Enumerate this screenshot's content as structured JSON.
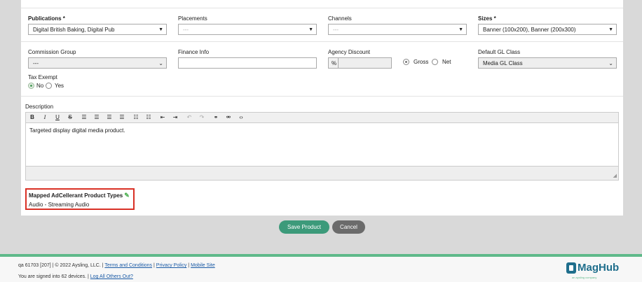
{
  "form": {
    "publications": {
      "label": "Publications *",
      "value": "Digital British Baking, Digital Pub"
    },
    "placements": {
      "label": "Placements",
      "value": "---"
    },
    "channels": {
      "label": "Channels",
      "value": "---"
    },
    "sizes": {
      "label": "Sizes *",
      "value": "Banner (100x200), Banner (200x300)"
    },
    "commission_group": {
      "label": "Commission Group",
      "value": "---"
    },
    "finance_info": {
      "label": "Finance Info",
      "value": ""
    },
    "agency_discount": {
      "label": "Agency Discount",
      "addon": "%",
      "value": ""
    },
    "gross_net": {
      "gross_label": "Gross",
      "net_label": "Net",
      "selected": "Gross"
    },
    "default_gl_class": {
      "label": "Default GL Class",
      "value": "Media GL Class"
    },
    "tax_exempt": {
      "label": "Tax Exempt",
      "no_label": "No",
      "yes_label": "Yes",
      "selected": "No"
    },
    "description": {
      "label": "Description",
      "text": "Targeted display digital media product."
    },
    "mapped": {
      "title": "Mapped AdCellerant Product Types",
      "value": "Audio - Streaming Audio"
    }
  },
  "toolbar": {
    "icons": [
      "bold-icon",
      "italic-icon",
      "underline-icon",
      "strikethrough-icon",
      "align-left-icon",
      "align-center-icon",
      "align-right-icon",
      "align-justify-icon",
      "bullet-list-icon",
      "numbered-list-icon",
      "outdent-icon",
      "indent-icon",
      "undo-icon",
      "redo-icon",
      "link-icon",
      "unlink-icon",
      "code-icon"
    ],
    "glyphs": {
      "bold": "B",
      "italic": "I",
      "underline": "U",
      "strike": "S"
    }
  },
  "actions": {
    "save_label": "Save Product",
    "cancel_label": "Cancel"
  },
  "footer": {
    "version": "qa 61703 [207] | © 2022 Aysling, LLC. |",
    "terms": "Terms and Conditions",
    "privacy": "Privacy Policy",
    "mobile": "Mobile Site",
    "signed_in": "You are signed into 62 devices. |",
    "logout_all": "Log All Others Out?",
    "logo_text": "MagHub",
    "logo_sub": "an aysling company"
  },
  "colors": {
    "accent": "#3c9a7a",
    "footer_bar": "#5fb98a",
    "highlight": "#d93025",
    "brand": "#1f6e8c"
  }
}
